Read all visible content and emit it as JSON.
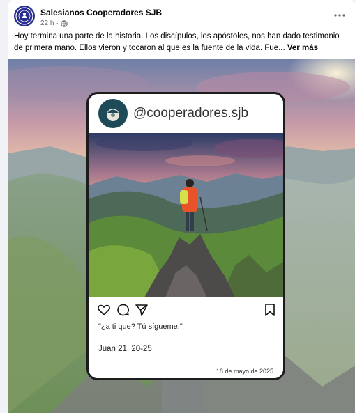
{
  "post": {
    "author": "Salesianos Cooperadores SJB",
    "time": "22 h",
    "time_separator": "·",
    "more_icon": "more-horizontal-icon",
    "privacy_icon": "globe-icon",
    "text": "Hoy termina una parte de la historia. Los discípulos, los apóstoles, nos han dado testimonio de primera mano. Ellos vieron y tocaron al que es la fuente de la vida. Fue...",
    "see_more": "Ver más"
  },
  "card": {
    "handle": "@cooperadores.sjb",
    "quote": "\"¿a ti que? Tú sígueme.\"",
    "verse": "Juan 21, 20-25",
    "date": "18 de mayo de 2025",
    "icons": [
      "heart-icon",
      "comment-icon",
      "share-icon",
      "bookmark-icon"
    ]
  },
  "colors": {
    "facebook_bg": "#f0f2f5",
    "text_secondary": "#65676b",
    "logo_blue": "#2a2f8f",
    "card_logo_teal": "#1f4a57",
    "hiker_jacket": "#e8532a"
  }
}
